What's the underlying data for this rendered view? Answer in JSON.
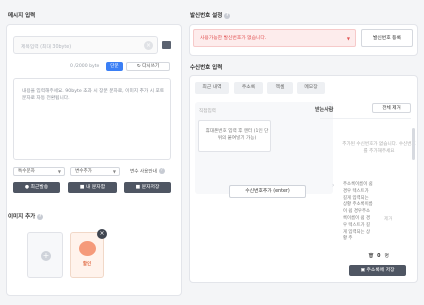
{
  "left": {
    "title": "메시지 입력",
    "subject_placeholder": "제목입력 (최대 30byte)",
    "bytes_label": "0 /2000 byte",
    "short_btn": "단문",
    "rewrite_btn": "다시쓰기",
    "message_placeholder": "내용을 입력해주세요. 90byte 초과 시 장문 문자로, 이미지 추가 시 포토 문자로 자동 전환됩니다.",
    "special_select": "특수문자",
    "variable_select": "변수추가",
    "guide_label": "변수 사용안내",
    "btn_recent": "최근발송",
    "btn_mymsg": "내 문자함",
    "btn_save": "문자저장",
    "image_title": "이미지 추가",
    "thumb_label": "할인"
  },
  "right": {
    "sender_title": "발신번호 설정",
    "sender_select": "사용가능한 발신번호가 없습니다.",
    "sender_register": "발신번호 등록",
    "receiver_title": "수신번호 입력",
    "tabs": [
      "최근 내역",
      "주소록",
      "엑셀",
      "메모장"
    ],
    "direct_label": "직접입력",
    "direct_hint": "휴대폰번호 입력 후 엔터 (1인 단위의 붙여넣기 가능)",
    "add_btn": "수신번호추가 (enter)",
    "receivers_title": "받는사람",
    "delete_all": "전체 제거",
    "empty_text": "추가된 수신번호가 없습니다. 수신번호를 추가해주세요",
    "note_text": "주소록이름이 쉼 경우 텍스트가 길게 입력되는 상황 주소록이름이 쉼 경우주소록이름이 쉼 경우 텍스트가 길게 입력되는 상황 주",
    "note_side": "제거",
    "count_num": "0",
    "count_unit": "명",
    "save_book": "주소록에 저장"
  }
}
